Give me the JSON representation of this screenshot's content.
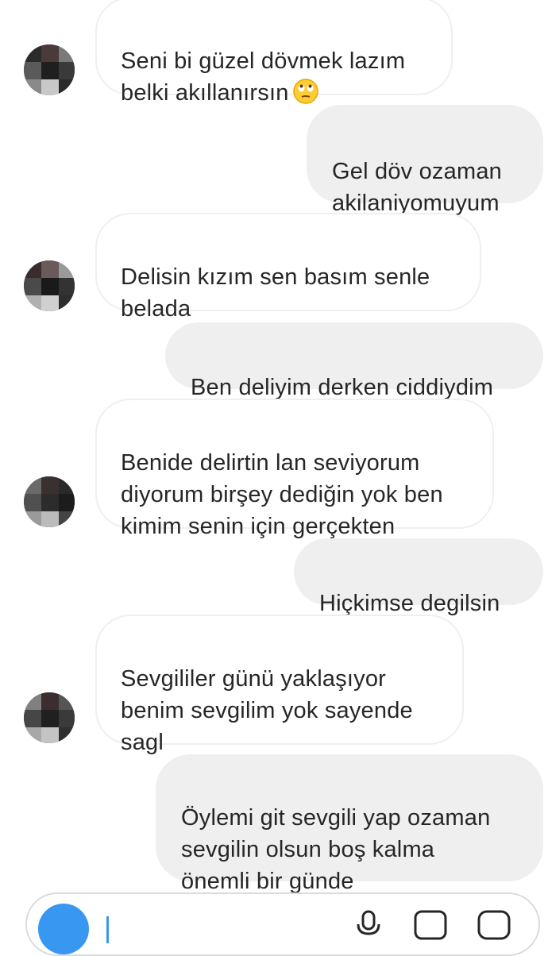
{
  "messages": [
    {
      "side": "received",
      "text": "Seni bi güzel dövmek lazım\nbelki akıllanırsın",
      "emoji": "face-with-rolling-eyes",
      "has_avatar": true
    },
    {
      "side": "sent",
      "text": "Gel döv ozaman\nakilaniyomuyum",
      "has_avatar": false
    },
    {
      "side": "received",
      "text": "Delisin kızım sen basım senle\nbelada",
      "has_avatar": true
    },
    {
      "side": "sent",
      "text": "Ben deliyim derken ciddiydim",
      "has_avatar": false
    },
    {
      "side": "received",
      "text": "Benide delirtin lan seviyorum\ndiyorum birşey dediğin yok ben\nkimim senin için gerçekten",
      "has_avatar": true
    },
    {
      "side": "sent",
      "text": "Hiçkimse degilsin",
      "has_avatar": false
    },
    {
      "side": "received",
      "text": "Sevgililer günü yaklaşıyor\nbenim sevgilim yok sayende\nsagl",
      "has_avatar": true
    },
    {
      "side": "sent",
      "text": "Öylemi git sevgili yap ozaman\nsevgilin olsun boş kalma\nönemli bir günde",
      "has_avatar": false
    }
  ],
  "composer": {
    "camera_icon": "camera-icon",
    "mic_icon": "microphone-icon",
    "gallery_icon": "gallery-icon",
    "sticker_icon": "sticker-icon"
  },
  "colors": {
    "sent_bubble": "#efefef",
    "received_border": "#efefef",
    "text": "#262626",
    "accent": "#3897f0"
  }
}
